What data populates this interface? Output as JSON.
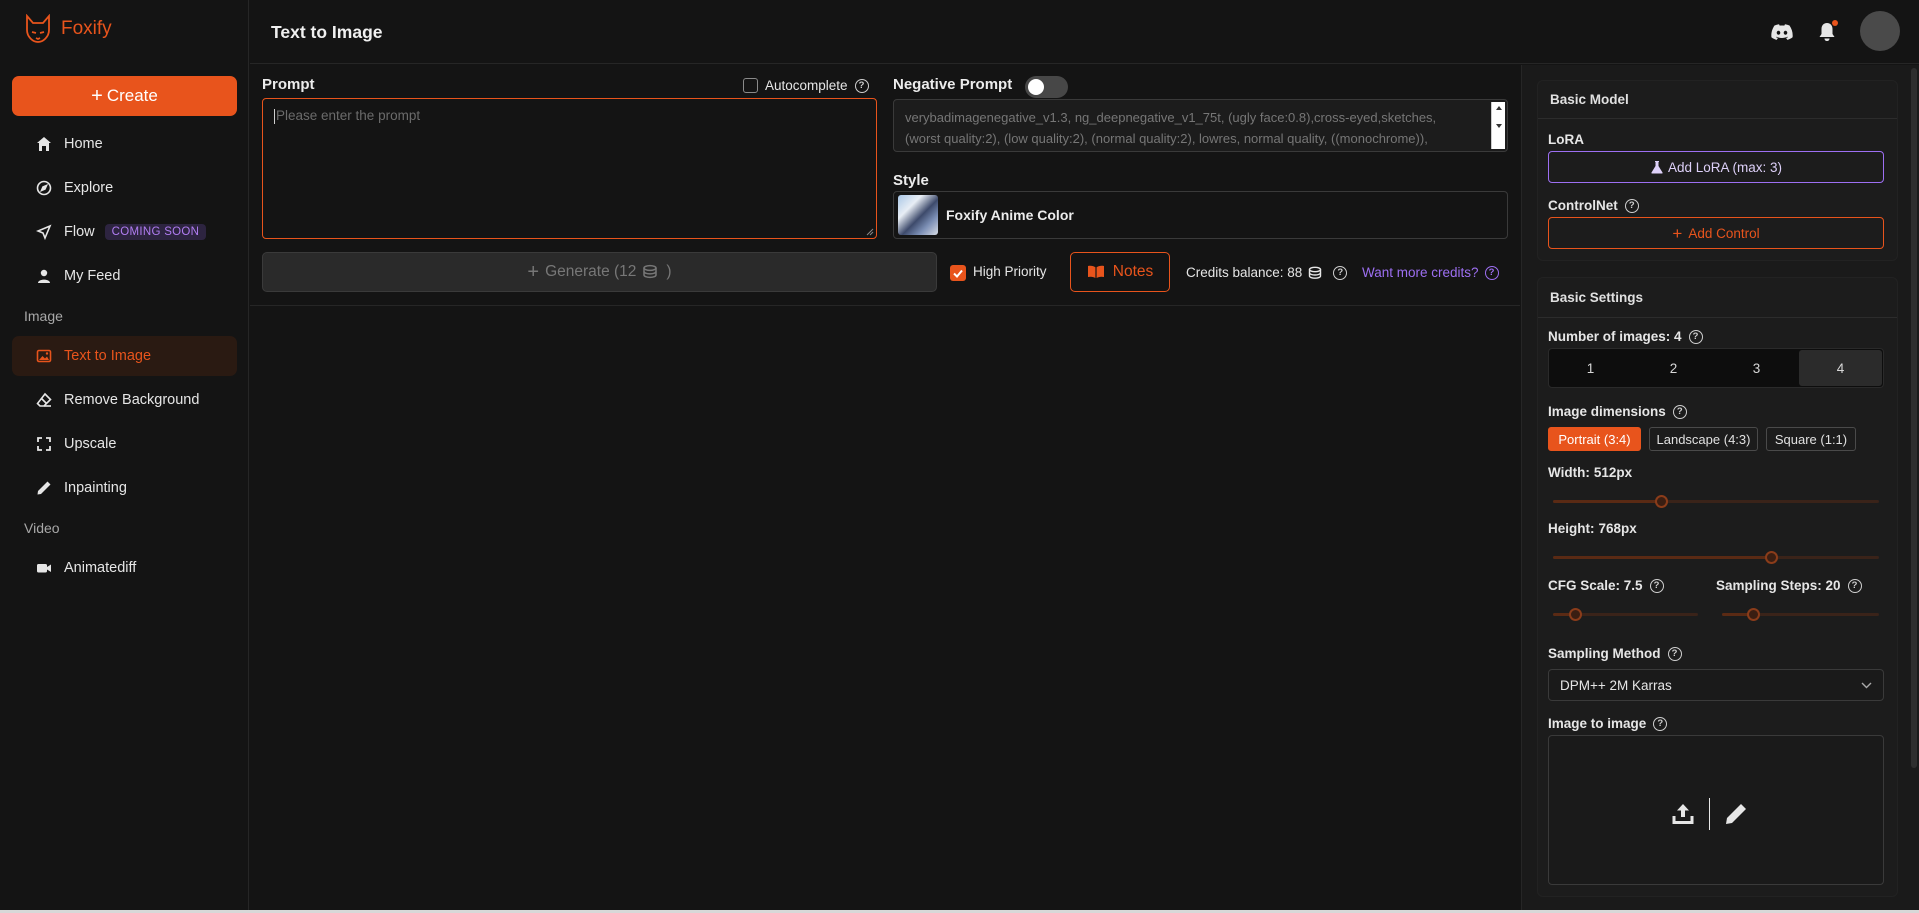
{
  "app": {
    "name": "Foxify",
    "accent": "#e8541c",
    "lora_color": "#9d6ff2"
  },
  "sidebar": {
    "create_label": "Create",
    "items": [
      {
        "label": "Home",
        "icon": "home-icon"
      },
      {
        "label": "Explore",
        "icon": "compass-icon"
      },
      {
        "label": "Flow",
        "icon": "send-icon",
        "badge": "COMING SOON"
      },
      {
        "label": "My Feed",
        "icon": "user-icon"
      }
    ],
    "image_section": "Image",
    "image_items": [
      {
        "label": "Text to Image",
        "icon": "image-icon",
        "active": true
      },
      {
        "label": "Remove Background",
        "icon": "eraser-icon"
      },
      {
        "label": "Upscale",
        "icon": "expand-icon"
      },
      {
        "label": "Inpainting",
        "icon": "pencil-icon"
      }
    ],
    "video_section": "Video",
    "video_items": [
      {
        "label": "Animatediff",
        "icon": "video-icon"
      }
    ]
  },
  "header": {
    "title": "Text to Image"
  },
  "prompt": {
    "label": "Prompt",
    "autocomplete_label": "Autocomplete",
    "autocomplete_checked": false,
    "placeholder": "Please enter the prompt"
  },
  "negative_prompt": {
    "label": "Negative Prompt",
    "enabled": false,
    "value": "verybadimagenegative_v1.3, ng_deepnegative_v1_75t, (ugly face:0.8),cross-eyed,sketches, (worst quality:2), (low quality:2), (normal quality:2), lowres, normal quality, ((monochrome)),"
  },
  "style": {
    "label": "Style",
    "name": "Foxify Anime Color"
  },
  "actions": {
    "generate_label": "Generate (12",
    "high_priority_label": "High Priority",
    "high_priority_checked": true,
    "notes_label": "Notes",
    "credits_label": "Credits balance: 88",
    "more_credits_label": "Want more credits?"
  },
  "basic_model": {
    "title": "Basic Model",
    "lora_label": "LoRA",
    "add_lora_label": "Add LoRA (max: 3)",
    "controlnet_label": "ControlNet",
    "add_control_label": "Add Control"
  },
  "basic_settings": {
    "title": "Basic Settings",
    "num_images_label": "Number of images: 4",
    "num_images_options": [
      "1",
      "2",
      "3",
      "4"
    ],
    "num_images_selected": "4",
    "dimensions_label": "Image dimensions",
    "dimension_options": [
      "Portrait (3:4)",
      "Landscape (4:3)",
      "Square (1:1)"
    ],
    "dimension_selected": "Portrait (3:4)",
    "width_label": "Width:",
    "width_value": "512px",
    "width_fraction": 0.33,
    "height_label": "Height:",
    "height_value": "768px",
    "height_fraction": 0.67,
    "cfg_label": "CFG Scale: 7.5",
    "cfg_fraction": 0.15,
    "steps_label": "Sampling Steps: 20",
    "steps_fraction": 0.2,
    "sampling_method_label": "Sampling Method",
    "sampling_method_value": "DPM++ 2M Karras",
    "img2img_label": "Image to image"
  }
}
